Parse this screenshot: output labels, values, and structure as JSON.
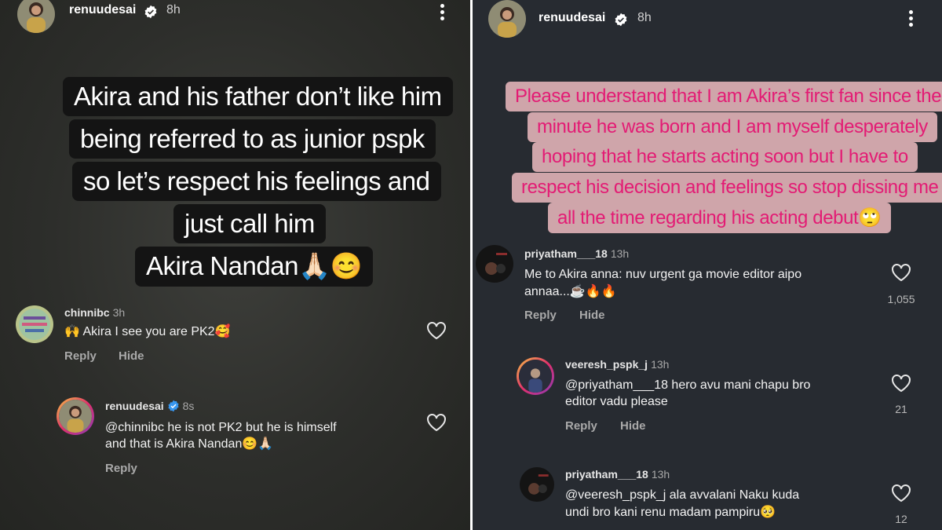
{
  "left": {
    "story": {
      "username": "renuudesai",
      "time": "8h"
    },
    "caption_lines": [
      "Akira and his father don’t like him",
      "being referred to as junior pspk",
      "so let’s respect his feelings and",
      "just call him",
      "Akira Nandan🙏🏻😊"
    ],
    "comments": [
      {
        "username": "chinnibc",
        "time": "3h",
        "text": "🙌 Akira I see you are PK2🥰",
        "reply": "Reply",
        "hide": "Hide"
      },
      {
        "username": "renuudesai",
        "time": "8s",
        "text_line1": "@chinnibc he is not PK2 but he is himself",
        "text_line2": "and that is Akira Nandan😊🙏🏻",
        "reply": "Reply"
      }
    ]
  },
  "right": {
    "story": {
      "username": "renuudesai",
      "time": "8h"
    },
    "caption_lines": [
      "Please understand that I am Akira’s first fan since the",
      "minute he was born and I am myself desperately",
      "hoping that he starts acting soon but I have to",
      "respect his decision and feelings so stop dissing me",
      "all the time regarding his acting debut🙄"
    ],
    "comments": [
      {
        "username": "priyatham___18",
        "time": "13h",
        "text_line1": "Me to Akira anna: nuv urgent ga movie editor aipo",
        "text_line2": "annaa...☕🔥🔥",
        "reply": "Reply",
        "hide": "Hide",
        "likes": "1,055"
      },
      {
        "username": "veeresh_pspk_j",
        "time": "13h",
        "text_line1": "@priyatham___18 hero avu mani chapu bro",
        "text_line2": "editor vadu please",
        "reply": "Reply",
        "hide": "Hide",
        "likes": "21"
      },
      {
        "username": "priyatham___18",
        "time": "13h",
        "text_line1": "@veeresh_pspk_j ala avvalani Naku kuda",
        "text_line2": "undi bro kani renu madam pampiru🥺",
        "likes": "12"
      }
    ]
  },
  "colors": {
    "left_bg": "#2f302d",
    "right_bg": "#272b31",
    "caption_dark_bg": "#141414",
    "caption_pink_bg": "#cfa5aa",
    "caption_pink_text": "#e31b74",
    "verified_blue": "#3897f0"
  },
  "icons": [
    "verified-badge-icon",
    "more-options-icon",
    "heart-icon"
  ]
}
